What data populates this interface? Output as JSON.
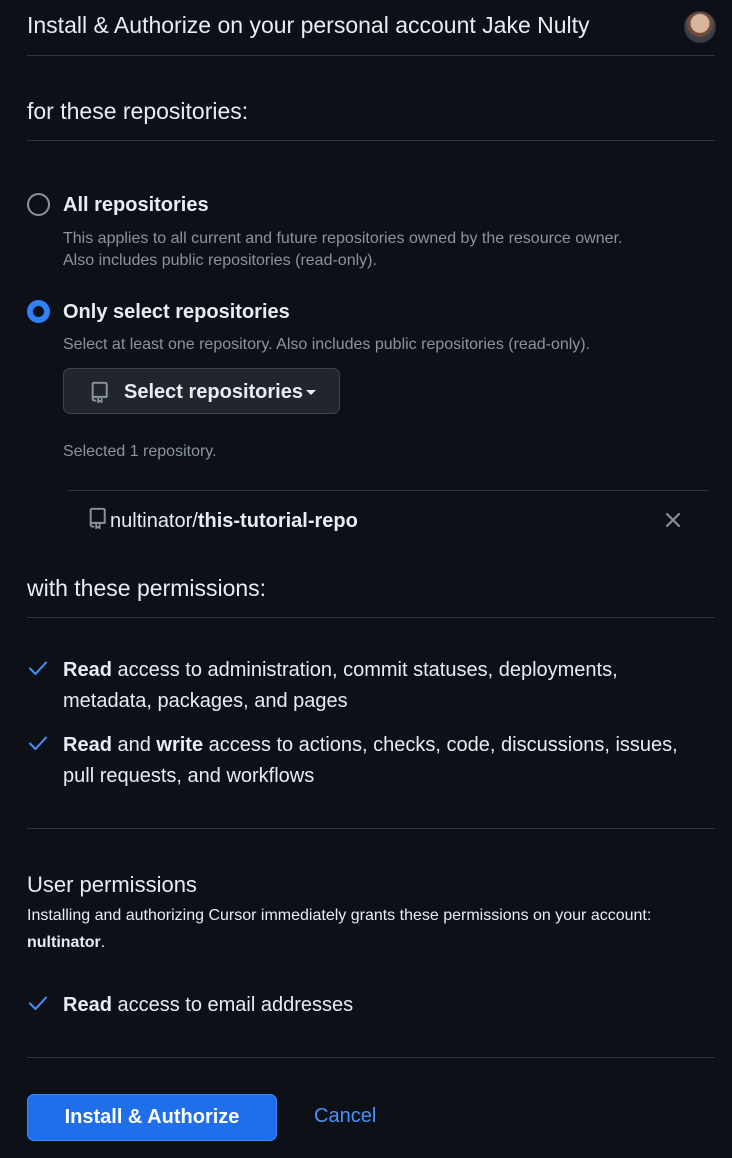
{
  "header": {
    "title": "Install & Authorize on your personal account Jake Nulty"
  },
  "repositories": {
    "section_title": "for these repositories:",
    "all": {
      "label": "All repositories",
      "desc_line1": "This applies to all current and future repositories owned by the resource owner.",
      "desc_line2": "Also includes public repositories (read-only).",
      "checked": false
    },
    "select": {
      "label": "Only select repositories",
      "desc": "Select at least one repository. Also includes public repositories (read-only).",
      "checked": true
    },
    "select_button_label": "Select repositories",
    "selected_count": "Selected 1 repository.",
    "selected": [
      {
        "owner": "nultinator/",
        "name": "this-tutorial-repo"
      }
    ]
  },
  "permissions": {
    "section_title": "with these permissions:",
    "items": [
      {
        "strong1": "Read",
        "mid": "",
        "strong2": "",
        "rest": " access to administration, commit statuses, deployments, metadata, packages, and pages"
      },
      {
        "strong1": "Read",
        "mid": " and ",
        "strong2": "write",
        "rest": " access to actions, checks, code, discussions, issues, pull requests, and workflows"
      }
    ]
  },
  "user_permissions": {
    "title": "User permissions",
    "desc": "Installing and authorizing Cursor immediately grants these permissions on your account: ",
    "account": "nultinator",
    "period": ".",
    "items": [
      {
        "strong": "Read",
        "rest": " access to email addresses"
      }
    ]
  },
  "actions": {
    "install_label": "Install & Authorize",
    "cancel_label": "Cancel"
  },
  "colors": {
    "background": "#0d1117",
    "accent": "#1f6feb",
    "link": "#4493f8",
    "muted": "#8b949e"
  }
}
